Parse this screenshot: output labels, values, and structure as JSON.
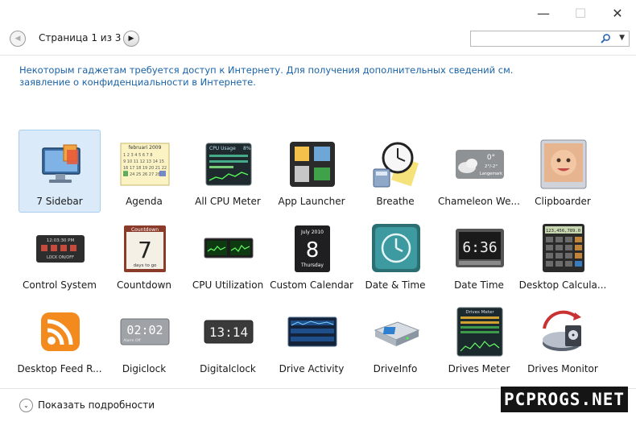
{
  "window": {
    "minimize_glyph": "—",
    "maximize_glyph": "☐",
    "close_glyph": "✕"
  },
  "toolbar": {
    "page_label": "Страница 1 из 3",
    "prev_glyph": "◀",
    "next_glyph": "▶",
    "search_value": "",
    "search_icon": "magnifier-icon",
    "dropdown_glyph": "▼"
  },
  "notice": "Некоторым гаджетам требуется доступ к Интернету. Для получения дополнительных сведений см. заявление о конфиденциальности в Интернете.",
  "gadgets": [
    {
      "label": "7 Sidebar",
      "icon": "monitor-icon",
      "selected": true
    },
    {
      "label": "Agenda",
      "icon": "calendar-icon"
    },
    {
      "label": "All CPU Meter",
      "icon": "cpu-meter-icon"
    },
    {
      "label": "App Launcher",
      "icon": "app-launcher-icon"
    },
    {
      "label": "Breathe",
      "icon": "clock-calculator-icon"
    },
    {
      "label": "Chameleon We...",
      "icon": "weather-icon"
    },
    {
      "label": "Clipboarder",
      "icon": "baby-photo-icon"
    },
    {
      "label": "Control System",
      "icon": "control-panel-icon"
    },
    {
      "label": "Countdown",
      "icon": "countdown-icon"
    },
    {
      "label": "CPU Utilization",
      "icon": "cpu-graph-icon"
    },
    {
      "label": "Custom Calendar",
      "icon": "custom-calendar-icon"
    },
    {
      "label": "Date & Time",
      "icon": "date-time-clock-icon"
    },
    {
      "label": "Date Time",
      "icon": "flip-clock-icon"
    },
    {
      "label": "Desktop Calcula...",
      "icon": "calculator-icon"
    },
    {
      "label": "Desktop Feed R...",
      "icon": "rss-icon"
    },
    {
      "label": "Digiclock",
      "icon": "digiclock-icon"
    },
    {
      "label": "Digitalclock",
      "icon": "digital-clock-icon"
    },
    {
      "label": "Drive Activity",
      "icon": "drive-activity-icon"
    },
    {
      "label": "DriveInfo",
      "icon": "hard-drive-icon"
    },
    {
      "label": "Drives Meter",
      "icon": "drives-meter-icon"
    },
    {
      "label": "Drives Monitor",
      "icon": "drives-monitor-icon"
    }
  ],
  "icon_text": {
    "agenda_title": "februari 2009",
    "cpu_title": "CPU Usage",
    "cpu_percent": "8%",
    "weather_temp": "0°",
    "weather_range": "2°/-2°",
    "weather_city": "Langemark",
    "control_time": "12:03:30 PM",
    "control_lock": "LOCK ON/OFF",
    "countdown_title": "Countdown",
    "countdown_num": "7",
    "countdown_sub": "days to go",
    "cal_month": "July 2010",
    "cal_day": "8",
    "cal_weekday": "Thursday",
    "flip_time": "6:36",
    "calc_display": "123,456,789.0",
    "digiclock_time": "02:02",
    "digiclock_sub": "Alarm Off",
    "digital_time": "13:14",
    "drives_meter_title": "Drives Meter"
  },
  "footer": {
    "label": "Показать подробности",
    "toggle_glyph": "⌄"
  },
  "watermark": "PCPROGS.NET"
}
